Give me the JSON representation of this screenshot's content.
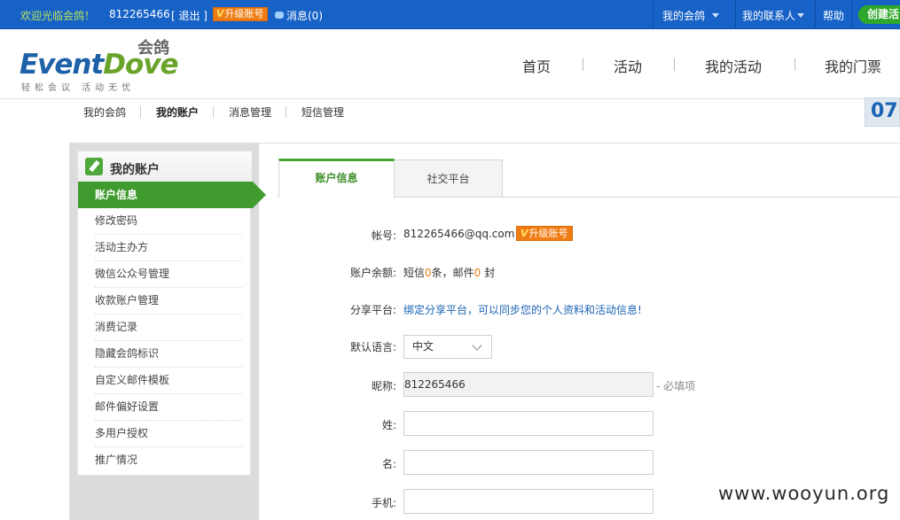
{
  "topbar": {
    "welcome": "欢迎光临会鸽！",
    "user_id": "812265466",
    "logout": "[ 退出 ]",
    "upgrade": "升级账号",
    "messages": "消息(0)",
    "my_huige": "我的会鸽",
    "my_contacts": "我的联系人",
    "help": "帮助",
    "create": "创建活"
  },
  "header": {
    "logo_brand_a": "Event",
    "logo_brand_b": "Dove",
    "logo_cn": "会鸽",
    "logo_slogan": "轻松会议 活动无忧",
    "nav": [
      "首页",
      "活动",
      "我的活动",
      "我的门票"
    ]
  },
  "subnav": {
    "items": [
      "我的会鸽",
      "我的账户",
      "消息管理",
      "短信管理"
    ],
    "date": "07"
  },
  "sidebar": {
    "title": "我的账户",
    "active": "账户信息",
    "items": [
      "修改密码",
      "活动主办方",
      "微信公众号管理",
      "收款账户管理",
      "消费记录",
      "隐藏会鸽标识",
      "自定义邮件模板",
      "邮件偏好设置",
      "多用户授权",
      "推广情况"
    ]
  },
  "tabs": {
    "account_info": "账户信息",
    "social": "社交平台"
  },
  "form": {
    "account_label": "帐号:",
    "account_value": "812265466@qq.com",
    "upgrade": "升级账号",
    "balance_label": "账户余额:",
    "balance_sms_prefix": "短信",
    "balance_sms_count": "0",
    "balance_mid": "条，邮件",
    "balance_mail_count": "0",
    "balance_suffix": "封",
    "share_label": "分享平台:",
    "share_text": "绑定分享平台，可以同步您的个人资料和活动信息!",
    "lang_label": "默认语言:",
    "lang_value": "中文",
    "nick_label": "昵称:",
    "nick_value": "812265466",
    "required_note": "- 必填项",
    "last_label": "姓:",
    "last_value": "",
    "first_label": "名:",
    "first_value": "",
    "phone_label": "手机:",
    "phone_value": ""
  },
  "watermark": "www.wooyun.org"
}
